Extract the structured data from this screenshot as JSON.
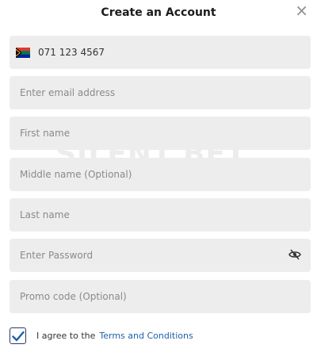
{
  "modal": {
    "title": "Create an Account",
    "close_icon": "×"
  },
  "fields": {
    "phone": {
      "value": "071 123 4567",
      "flag": "south-africa-flag"
    },
    "email": {
      "placeholder": "Enter email address"
    },
    "first_name": {
      "placeholder": "First name"
    },
    "middle_name": {
      "placeholder": "Middle name (Optional)"
    },
    "last_name": {
      "placeholder": "Last name"
    },
    "password": {
      "placeholder": "Enter Password",
      "toggle_icon": "eye-slash-icon"
    },
    "promo": {
      "placeholder": "Promo code (Optional)"
    }
  },
  "agreement": {
    "checked": true,
    "prefix": "I agree to the",
    "link": "Terms and Conditions"
  },
  "watermark": {
    "text": "SILENT  BET"
  },
  "colors": {
    "field_bg": "#ededed",
    "link": "#1f5fa8",
    "check": "#1f5fa8"
  }
}
